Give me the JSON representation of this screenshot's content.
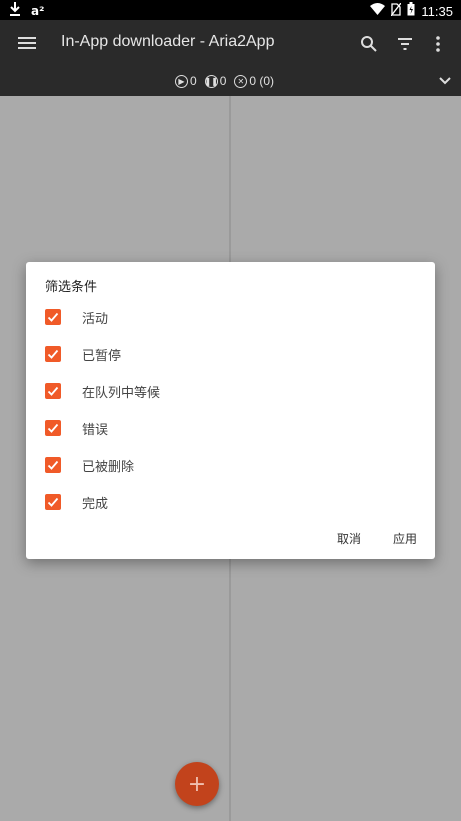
{
  "status_bar": {
    "left_icons": [
      "download-icon",
      "a2-icon"
    ],
    "a2_label": "a²",
    "time": "11:35",
    "right_icons": [
      "wifi-icon",
      "no-sim-icon",
      "battery-icon"
    ]
  },
  "toolbar": {
    "title": "In-App downloader - Aria2App",
    "actions": [
      "search-icon",
      "filter-icon",
      "more-vert-icon"
    ]
  },
  "counters": {
    "active": "0",
    "paused": "0",
    "stopped": "0 (0)"
  },
  "dialog": {
    "title": "筛选条件",
    "options": [
      {
        "label": "活动",
        "checked": true
      },
      {
        "label": "已暂停",
        "checked": true
      },
      {
        "label": "在队列中等候",
        "checked": true
      },
      {
        "label": "错误",
        "checked": true
      },
      {
        "label": "已被删除",
        "checked": true
      },
      {
        "label": "完成",
        "checked": true
      }
    ],
    "cancel_label": "取消",
    "apply_label": "应用"
  },
  "fab": {
    "label": "+"
  },
  "colors": {
    "accent": "#f05a28",
    "toolbar": "#2a2a2a",
    "scrim": "#aaaaaa",
    "fab": "#c2431c"
  }
}
